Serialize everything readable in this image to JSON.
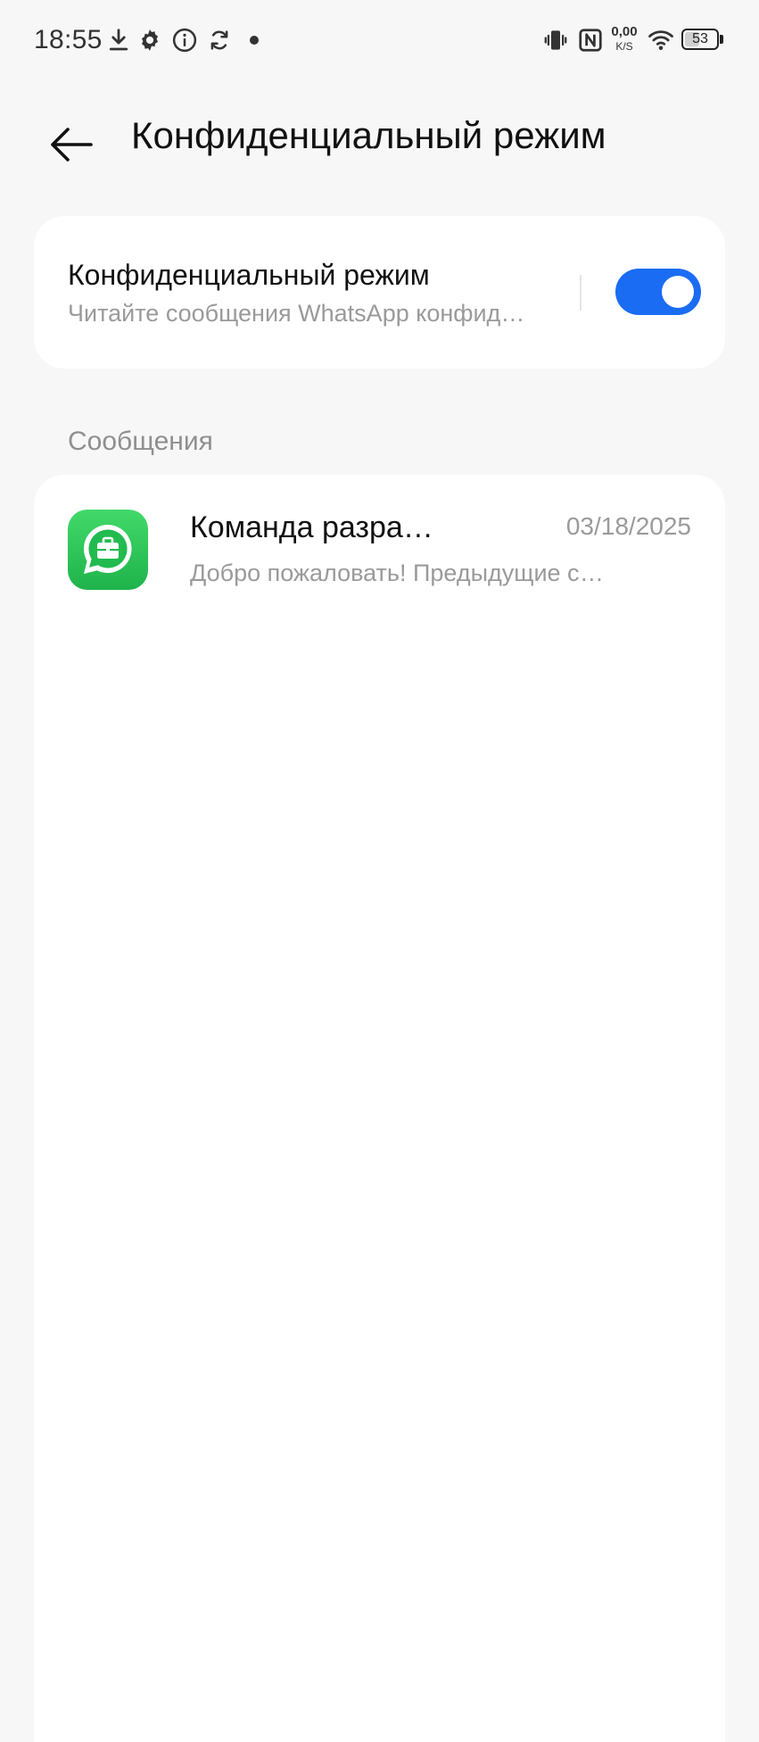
{
  "status_bar": {
    "time": "18:55",
    "net_speed_value": "0,00",
    "net_speed_unit": "K/S",
    "battery_level": "53",
    "battery_fraction": 0.53
  },
  "header": {
    "title": "Конфиденциальный режим",
    "back_icon": "arrow-left-icon"
  },
  "privacy_toggle": {
    "title": "Конфиденциальный режим",
    "subtitle": "Читайте сообщения WhatsApp конфиденциально",
    "enabled": true,
    "accent_color": "#1a6cf3"
  },
  "messages_section": {
    "label": "Сообщения",
    "items": [
      {
        "title": "Команда разработчиков",
        "date": "03/18/2025",
        "preview": "Добро пожаловать! Предыдущие сообщения",
        "icon": "whatsapp-business-icon",
        "icon_color": "#25c557"
      }
    ]
  }
}
